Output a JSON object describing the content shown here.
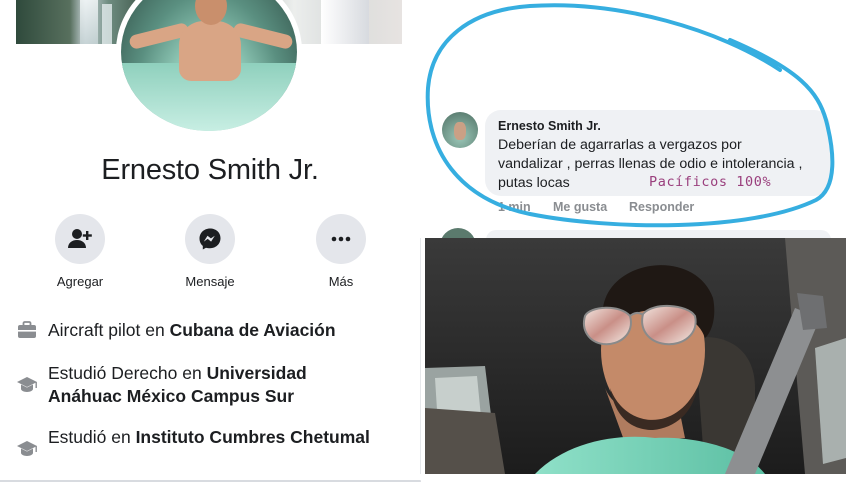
{
  "profile": {
    "name": "Ernesto Smith Jr.",
    "actions": [
      {
        "label": "Agregar",
        "icon": "add-friend-icon"
      },
      {
        "label": "Mensaje",
        "icon": "messenger-icon"
      },
      {
        "label": "Más",
        "icon": "more-icon"
      }
    ],
    "info": [
      {
        "icon": "briefcase-icon",
        "prefix": "Aircraft pilot en ",
        "bold": "Cubana de Aviación"
      },
      {
        "icon": "graduation-cap-icon",
        "prefix": "Estudió Derecho en ",
        "bold": "Universidad",
        "bold_line2": "Anáhuac México Campus Sur"
      },
      {
        "icon": "graduation-cap-icon",
        "prefix": "Estudió en ",
        "bold": "Instituto Cumbres Chetumal"
      }
    ]
  },
  "comment": {
    "author": "Ernesto Smith Jr.",
    "lines": [
      "Deberían de agarrarlas a vergazos por",
      "vandalizar , perras llenas de odio e intolerancia ,",
      "putas locas"
    ],
    "handwritten_tag": "Pacíficos 100%",
    "meta": {
      "time": "1 min",
      "like": "Me gusta",
      "reply": "Responder"
    },
    "highlight_color": "#36aee0"
  },
  "colors": {
    "text": "#1c1e21",
    "action_bg": "#e4e6eb",
    "bubble_bg": "#eff1f4",
    "meta_text": "#8a8d91"
  }
}
